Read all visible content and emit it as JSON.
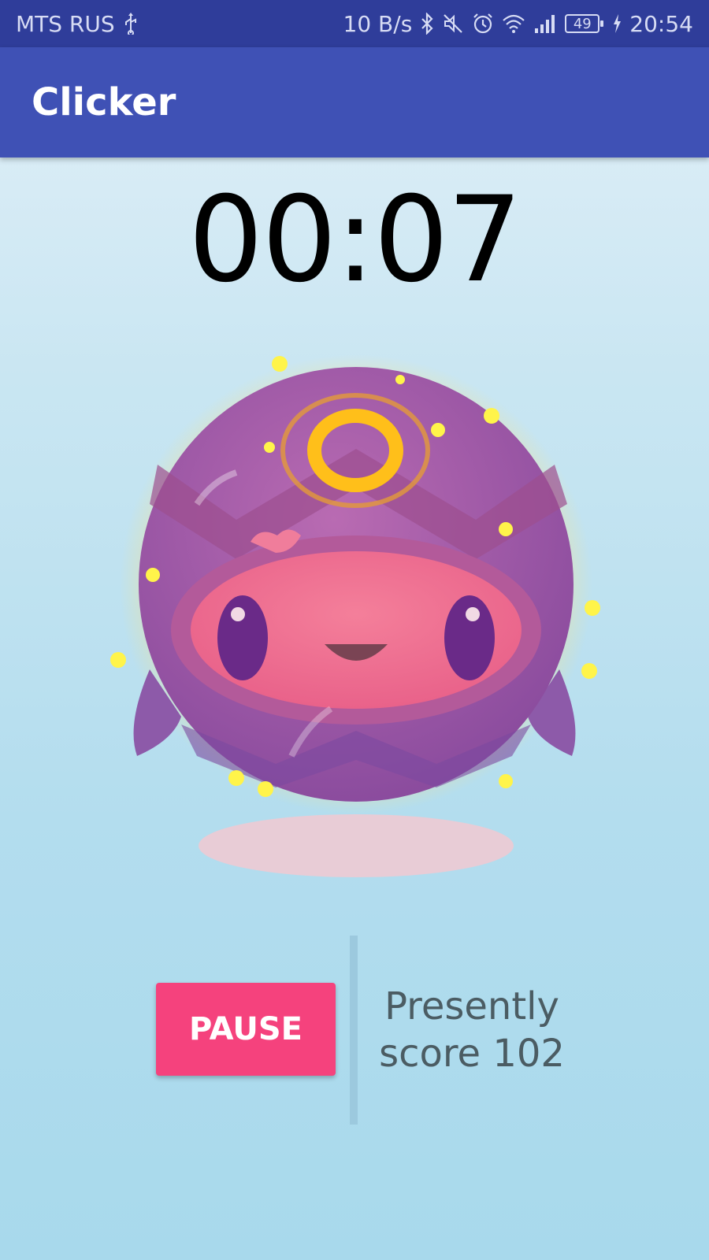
{
  "status_bar": {
    "carrier": "MTS RUS",
    "network_speed": "10 B/s",
    "battery": "49",
    "time": "20:54",
    "icons": [
      "usb-icon",
      "bluetooth-icon",
      "mute-icon",
      "alarm-icon",
      "wifi-icon",
      "signal-icon",
      "battery-icon",
      "charging-icon"
    ]
  },
  "app_bar": {
    "title": "Clicker"
  },
  "timer": {
    "value": "00:07"
  },
  "controls": {
    "pause_label": "PAUSE"
  },
  "score": {
    "label": "Presently",
    "prefix": "score",
    "value": "102"
  },
  "colors": {
    "status_bar": "#2f3d9a",
    "app_bar": "#3f51b5",
    "accent": "#f5427d",
    "score_text": "#4b5c63"
  }
}
